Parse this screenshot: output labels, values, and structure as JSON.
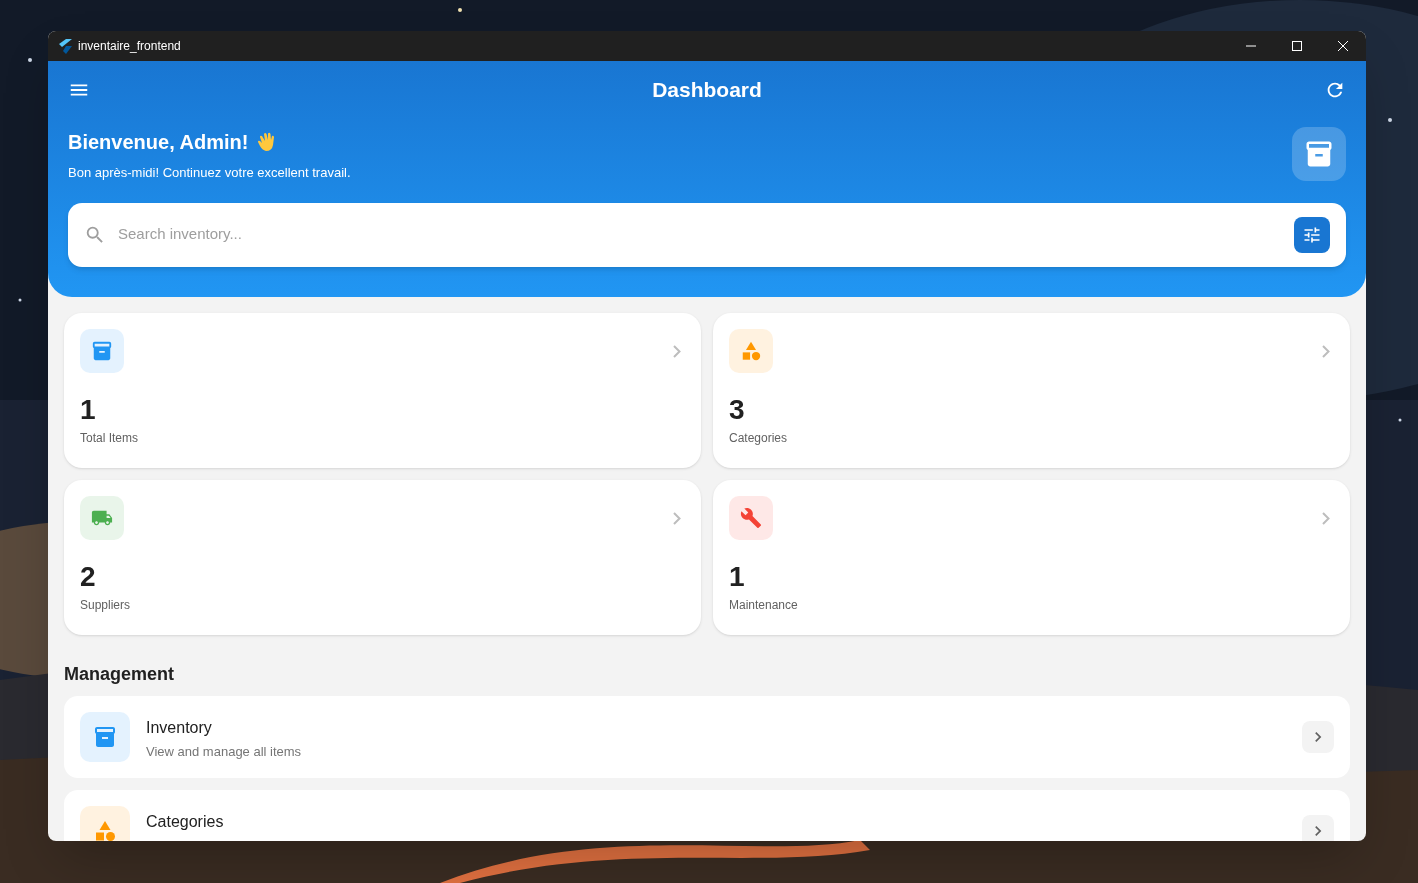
{
  "window": {
    "title": "inventaire_frontend"
  },
  "header": {
    "title": "Dashboard",
    "greeting": "Bienvenue, Admin!",
    "subtitle": "Bon après-midi! Continuez votre excellent travail."
  },
  "search": {
    "placeholder": "Search inventory..."
  },
  "stats": [
    {
      "kind": "box",
      "color": "#2196f3",
      "value": "1",
      "label": "Total Items"
    },
    {
      "kind": "shapes",
      "color": "#ff9800",
      "value": "3",
      "label": "Categories"
    },
    {
      "kind": "truck",
      "color": "#4caf50",
      "value": "2",
      "label": "Suppliers"
    },
    {
      "kind": "wrench",
      "color": "#f44336",
      "value": "1",
      "label": "Maintenance"
    }
  ],
  "management": {
    "title": "Management",
    "items": [
      {
        "kind": "box",
        "color": "#2196f3",
        "title": "Inventory",
        "subtitle": "View and manage all items"
      },
      {
        "kind": "shapes",
        "color": "#ff9800",
        "title": "Categories"
      }
    ]
  }
}
